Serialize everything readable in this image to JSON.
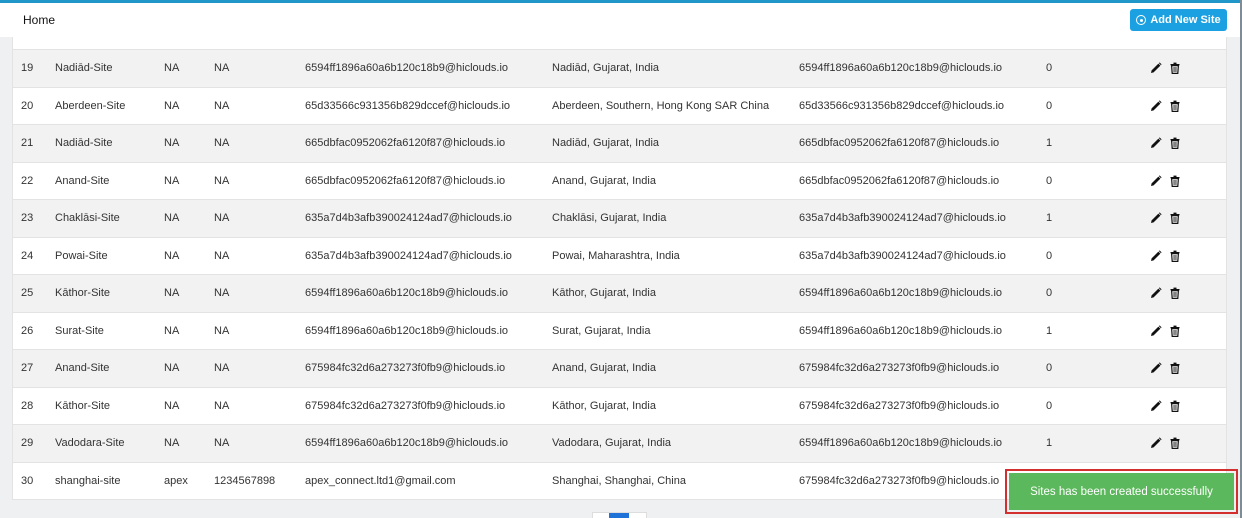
{
  "header": {
    "title": "Home",
    "add_button_label": "Add New Site"
  },
  "rows": [
    {
      "id": "19",
      "name": "Nadiād-Site",
      "col_a": "NA",
      "col_b": "NA",
      "email": "6594ff1896a60a6b120c18b9@hiclouds.io",
      "location": "Nadiād, Gujarat, India",
      "email2": "6594ff1896a60a6b120c18b9@hiclouds.io",
      "count": "0"
    },
    {
      "id": "20",
      "name": "Aberdeen-Site",
      "col_a": "NA",
      "col_b": "NA",
      "email": "65d33566c931356b829dccef@hiclouds.io",
      "location": "Aberdeen, Southern, Hong Kong SAR China",
      "email2": "65d33566c931356b829dccef@hiclouds.io",
      "count": "0"
    },
    {
      "id": "21",
      "name": "Nadiād-Site",
      "col_a": "NA",
      "col_b": "NA",
      "email": "665dbfac0952062fa6120f87@hiclouds.io",
      "location": "Nadiād, Gujarat, India",
      "email2": "665dbfac0952062fa6120f87@hiclouds.io",
      "count": "1"
    },
    {
      "id": "22",
      "name": "Anand-Site",
      "col_a": "NA",
      "col_b": "NA",
      "email": "665dbfac0952062fa6120f87@hiclouds.io",
      "location": "Anand, Gujarat, India",
      "email2": "665dbfac0952062fa6120f87@hiclouds.io",
      "count": "0"
    },
    {
      "id": "23",
      "name": "Chaklāsi-Site",
      "col_a": "NA",
      "col_b": "NA",
      "email": "635a7d4b3afb390024124ad7@hiclouds.io",
      "location": "Chaklāsi, Gujarat, India",
      "email2": "635a7d4b3afb390024124ad7@hiclouds.io",
      "count": "1"
    },
    {
      "id": "24",
      "name": "Powai-Site",
      "col_a": "NA",
      "col_b": "NA",
      "email": "635a7d4b3afb390024124ad7@hiclouds.io",
      "location": "Powai, Maharashtra, India",
      "email2": "635a7d4b3afb390024124ad7@hiclouds.io",
      "count": "0"
    },
    {
      "id": "25",
      "name": "Kāthor-Site",
      "col_a": "NA",
      "col_b": "NA",
      "email": "6594ff1896a60a6b120c18b9@hiclouds.io",
      "location": "Kāthor, Gujarat, India",
      "email2": "6594ff1896a60a6b120c18b9@hiclouds.io",
      "count": "0"
    },
    {
      "id": "26",
      "name": "Surat-Site",
      "col_a": "NA",
      "col_b": "NA",
      "email": "6594ff1896a60a6b120c18b9@hiclouds.io",
      "location": "Surat, Gujarat, India",
      "email2": "6594ff1896a60a6b120c18b9@hiclouds.io",
      "count": "1"
    },
    {
      "id": "27",
      "name": "Anand-Site",
      "col_a": "NA",
      "col_b": "NA",
      "email": "675984fc32d6a273273f0fb9@hiclouds.io",
      "location": "Anand, Gujarat, India",
      "email2": "675984fc32d6a273273f0fb9@hiclouds.io",
      "count": "0"
    },
    {
      "id": "28",
      "name": "Kāthor-Site",
      "col_a": "NA",
      "col_b": "NA",
      "email": "675984fc32d6a273273f0fb9@hiclouds.io",
      "location": "Kāthor, Gujarat, India",
      "email2": "675984fc32d6a273273f0fb9@hiclouds.io",
      "count": "0"
    },
    {
      "id": "29",
      "name": "Vadodara-Site",
      "col_a": "NA",
      "col_b": "NA",
      "email": "6594ff1896a60a6b120c18b9@hiclouds.io",
      "location": "Vadodara, Gujarat, India",
      "email2": "6594ff1896a60a6b120c18b9@hiclouds.io",
      "count": "1"
    },
    {
      "id": "30",
      "name": "shanghai-site",
      "col_a": "apex",
      "col_b": "1234567898",
      "email": "apex_connect.ltd1@gmail.com",
      "location": "Shanghai, Shanghai, China",
      "email2": "675984fc32d6a273273f0fb9@hiclouds.io",
      "count": ""
    }
  ],
  "row_actions": {
    "edit_icon": "pencil-icon",
    "delete_icon": "trash-icon"
  },
  "toast": {
    "message": "Sites has been created successfully"
  },
  "pagination": {
    "current_page": ""
  },
  "colors": {
    "accent": "#1ba1e2",
    "toast_bg": "#5cb85c",
    "highlight_border": "#d32f2f"
  }
}
